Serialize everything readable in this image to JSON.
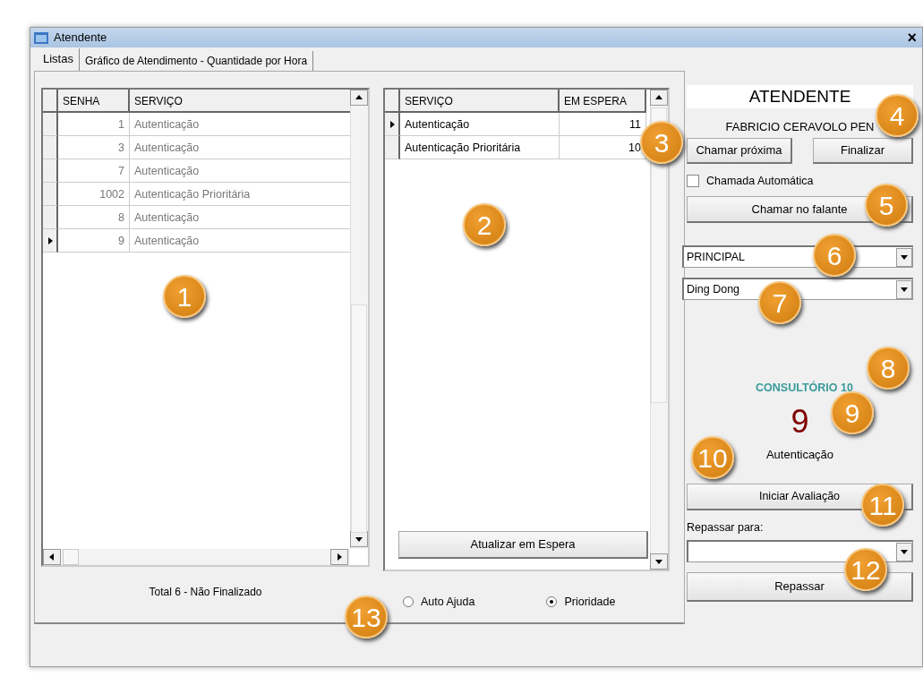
{
  "window": {
    "title": "Atendente",
    "close": "×"
  },
  "tabs": [
    {
      "label": "Listas",
      "selected": true
    },
    {
      "label": "Gráfico de Atendimento - Quantidade por Hora",
      "selected": false
    }
  ],
  "tickets_table": {
    "columns": [
      "SENHA",
      "SERVIÇO"
    ],
    "rows": [
      {
        "senha": "1",
        "servico": "Autenticação",
        "selected": false
      },
      {
        "senha": "3",
        "servico": "Autenticação",
        "selected": false
      },
      {
        "senha": "7",
        "servico": "Autenticação",
        "selected": false
      },
      {
        "senha": "1002",
        "servico": "Autenticação Prioritária",
        "selected": false
      },
      {
        "senha": "8",
        "servico": "Autenticação",
        "selected": false
      },
      {
        "senha": "9",
        "servico": "Autenticação",
        "selected": true
      }
    ]
  },
  "total_label": "Total 6 -  Não Finalizado",
  "waiting_table": {
    "columns": [
      "SERVIÇO",
      "EM ESPERA"
    ],
    "rows": [
      {
        "servico": "Autenticação",
        "em_espera": "11",
        "selected": true
      },
      {
        "servico": "Autenticação Prioritária",
        "em_espera": "10",
        "selected": false
      }
    ]
  },
  "refresh_button": "Atualizar em Espera",
  "radios": [
    {
      "label": "Auto Ajuda",
      "selected": false
    },
    {
      "label": "Prioridade",
      "selected": true
    }
  ],
  "panel": {
    "heading": "ATENDENTE",
    "attendant": "FABRICIO CERAVOLO PEN",
    "call_next_button": "Chamar próxima",
    "finish_button": "Finalizar",
    "auto_call": {
      "label": "Chamada Automática",
      "checked": false
    },
    "speaker_button": "Chamar no falante",
    "queue_select": "PRINCIPAL",
    "sound_select": "Ding Dong",
    "room": "CONSULTÓRIO 10",
    "current_ticket": "9",
    "current_service": "Autenticação",
    "evaluation_button": "Iniciar Avaliação",
    "forward_label": "Repassar para:",
    "forward_button": "Repassar"
  },
  "callouts": [
    "1",
    "2",
    "3",
    "4",
    "5",
    "6",
    "7",
    "8",
    "9",
    "10",
    "11",
    "12",
    "13"
  ]
}
